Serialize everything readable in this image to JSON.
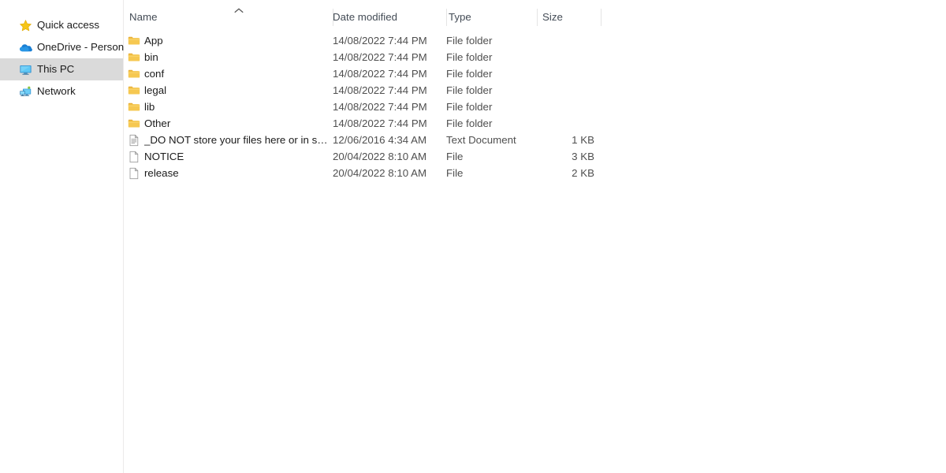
{
  "nav_pane": {
    "items": [
      {
        "label": "Quick access",
        "icon": "star-icon",
        "selected": false
      },
      {
        "label": "OneDrive - Personal",
        "icon": "onedrive-cloud-icon",
        "selected": false
      },
      {
        "label": "This PC",
        "icon": "monitor-icon",
        "selected": true
      },
      {
        "label": "Network",
        "icon": "network-icon",
        "selected": false
      }
    ]
  },
  "file_list": {
    "sort_indicator": "˄",
    "sort_column": "Name",
    "sort_direction": "ascending",
    "columns": [
      {
        "key": "name",
        "label": "Name"
      },
      {
        "key": "date_modified",
        "label": "Date modified"
      },
      {
        "key": "type",
        "label": "Type"
      },
      {
        "key": "size",
        "label": "Size"
      }
    ],
    "rows": [
      {
        "name": "App",
        "date_modified": "14/08/2022 7:44 PM",
        "type": "File folder",
        "size": "",
        "icon": "folder-icon"
      },
      {
        "name": "bin",
        "date_modified": "14/08/2022 7:44 PM",
        "type": "File folder",
        "size": "",
        "icon": "folder-icon"
      },
      {
        "name": "conf",
        "date_modified": "14/08/2022 7:44 PM",
        "type": "File folder",
        "size": "",
        "icon": "folder-icon"
      },
      {
        "name": "legal",
        "date_modified": "14/08/2022 7:44 PM",
        "type": "File folder",
        "size": "",
        "icon": "folder-icon"
      },
      {
        "name": "lib",
        "date_modified": "14/08/2022 7:44 PM",
        "type": "File folder",
        "size": "",
        "icon": "folder-icon"
      },
      {
        "name": "Other",
        "date_modified": "14/08/2022 7:44 PM",
        "type": "File folder",
        "size": "",
        "icon": "folder-icon"
      },
      {
        "name": "_DO NOT store your files here or in subfol...",
        "date_modified": "12/06/2016 4:34 AM",
        "type": "Text Document",
        "size": "1 KB",
        "icon": "text-document-icon"
      },
      {
        "name": "NOTICE",
        "date_modified": "20/04/2022 8:10 AM",
        "type": "File",
        "size": "3 KB",
        "icon": "generic-file-icon"
      },
      {
        "name": "release",
        "date_modified": "20/04/2022 8:10 AM",
        "type": "File",
        "size": "2 KB",
        "icon": "generic-file-icon"
      }
    ]
  },
  "colors": {
    "folder_yellow": "#f6c851",
    "folder_yellow_dark": "#e8ae36",
    "selection_gray": "#dadada",
    "header_text": "#444c56",
    "body_text": "#1b1b1b",
    "secondary_text": "#4f4f4f",
    "onedrive_blue": "#1a7fd4",
    "monitor_blue": "#27a5e8",
    "star_gold": "#f5c518"
  }
}
